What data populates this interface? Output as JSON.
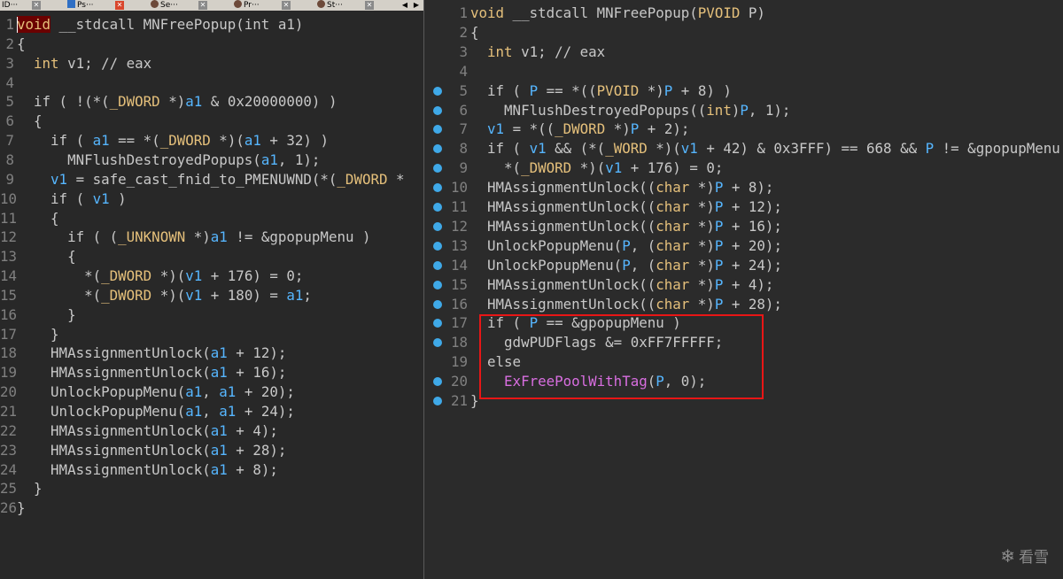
{
  "tabs": [
    {
      "label": "ID···"
    },
    {
      "label": "Ps···"
    },
    {
      "label": "Se···"
    },
    {
      "label": "Pr···"
    },
    {
      "label": "St···"
    }
  ],
  "tab_nav": {
    "prev": "◀",
    "next": "▶"
  },
  "left_pane": {
    "lines": [
      {
        "n": "1",
        "t": [
          {
            "c": "vhl",
            "s": "void"
          },
          {
            "s": " __stdcall MNFreePopup(int a1)"
          }
        ]
      },
      {
        "n": "2",
        "t": [
          {
            "s": "{"
          }
        ]
      },
      {
        "n": "3",
        "t": [
          {
            "s": "  "
          },
          {
            "c": "k",
            "s": "int"
          },
          {
            "s": " v1; // eax"
          }
        ]
      },
      {
        "n": "4",
        "t": []
      },
      {
        "n": "5",
        "t": [
          {
            "s": "  if ( !(*("
          },
          {
            "c": "k",
            "s": "_DWORD"
          },
          {
            "s": " *)"
          },
          {
            "c": "v",
            "s": "a1"
          },
          {
            "s": " & 0x20000000) )"
          }
        ]
      },
      {
        "n": "6",
        "t": [
          {
            "s": "  {"
          }
        ]
      },
      {
        "n": "7",
        "t": [
          {
            "s": "    if ( "
          },
          {
            "c": "v",
            "s": "a1"
          },
          {
            "s": " == *("
          },
          {
            "c": "k",
            "s": "_DWORD"
          },
          {
            "s": " *)("
          },
          {
            "c": "v",
            "s": "a1"
          },
          {
            "s": " + 32) )"
          }
        ]
      },
      {
        "n": "8",
        "t": [
          {
            "s": "      MNFlushDestroyedPopups("
          },
          {
            "c": "v",
            "s": "a1"
          },
          {
            "s": ", 1);"
          }
        ]
      },
      {
        "n": "9",
        "t": [
          {
            "s": "    "
          },
          {
            "c": "v",
            "s": "v1"
          },
          {
            "s": " = safe_cast_fnid_to_PMENUWND(*("
          },
          {
            "c": "k",
            "s": "_DWORD"
          },
          {
            "s": " *"
          }
        ]
      },
      {
        "n": "10",
        "t": [
          {
            "s": "    if ( "
          },
          {
            "c": "v",
            "s": "v1"
          },
          {
            "s": " )"
          }
        ]
      },
      {
        "n": "11",
        "t": [
          {
            "s": "    {"
          }
        ]
      },
      {
        "n": "12",
        "t": [
          {
            "s": "      if ( ("
          },
          {
            "c": "k",
            "s": "_UNKNOWN"
          },
          {
            "s": " *)"
          },
          {
            "c": "v",
            "s": "a1"
          },
          {
            "s": " != &gpopupMenu )"
          }
        ]
      },
      {
        "n": "13",
        "t": [
          {
            "s": "      {"
          }
        ]
      },
      {
        "n": "14",
        "t": [
          {
            "s": "        *("
          },
          {
            "c": "k",
            "s": "_DWORD"
          },
          {
            "s": " *)("
          },
          {
            "c": "v",
            "s": "v1"
          },
          {
            "s": " + 176) = 0;"
          }
        ]
      },
      {
        "n": "15",
        "t": [
          {
            "s": "        *("
          },
          {
            "c": "k",
            "s": "_DWORD"
          },
          {
            "s": " *)("
          },
          {
            "c": "v",
            "s": "v1"
          },
          {
            "s": " + 180) = "
          },
          {
            "c": "v",
            "s": "a1"
          },
          {
            "s": ";"
          }
        ]
      },
      {
        "n": "16",
        "t": [
          {
            "s": "      }"
          }
        ]
      },
      {
        "n": "17",
        "t": [
          {
            "s": "    }"
          }
        ]
      },
      {
        "n": "18",
        "t": [
          {
            "s": "    HMAssignmentUnlock("
          },
          {
            "c": "v",
            "s": "a1"
          },
          {
            "s": " + 12);"
          }
        ]
      },
      {
        "n": "19",
        "t": [
          {
            "s": "    HMAssignmentUnlock("
          },
          {
            "c": "v",
            "s": "a1"
          },
          {
            "s": " + 16);"
          }
        ]
      },
      {
        "n": "20",
        "t": [
          {
            "s": "    UnlockPopupMenu("
          },
          {
            "c": "v",
            "s": "a1"
          },
          {
            "s": ", "
          },
          {
            "c": "v",
            "s": "a1"
          },
          {
            "s": " + 20);"
          }
        ]
      },
      {
        "n": "21",
        "t": [
          {
            "s": "    UnlockPopupMenu("
          },
          {
            "c": "v",
            "s": "a1"
          },
          {
            "s": ", "
          },
          {
            "c": "v",
            "s": "a1"
          },
          {
            "s": " + 24);"
          }
        ]
      },
      {
        "n": "22",
        "t": [
          {
            "s": "    HMAssignmentUnlock("
          },
          {
            "c": "v",
            "s": "a1"
          },
          {
            "s": " + 4);"
          }
        ]
      },
      {
        "n": "23",
        "t": [
          {
            "s": "    HMAssignmentUnlock("
          },
          {
            "c": "v",
            "s": "a1"
          },
          {
            "s": " + 28);"
          }
        ]
      },
      {
        "n": "24",
        "t": [
          {
            "s": "    HMAssignmentUnlock("
          },
          {
            "c": "v",
            "s": "a1"
          },
          {
            "s": " + 8);"
          }
        ]
      },
      {
        "n": "25",
        "t": [
          {
            "s": "  }"
          }
        ]
      },
      {
        "n": "26",
        "t": [
          {
            "s": "}"
          }
        ]
      }
    ]
  },
  "right_pane": {
    "lines": [
      {
        "n": "1",
        "t": [
          {
            "c": "k",
            "s": "void"
          },
          {
            "s": " __stdcall MNFreePopup("
          },
          {
            "c": "k",
            "s": "PVOID"
          },
          {
            "s": " P)"
          }
        ]
      },
      {
        "n": "2",
        "t": [
          {
            "s": "{"
          }
        ]
      },
      {
        "n": "3",
        "t": [
          {
            "s": "  "
          },
          {
            "c": "k",
            "s": "int"
          },
          {
            "s": " v1; // eax"
          }
        ]
      },
      {
        "n": "4",
        "t": []
      },
      {
        "n": "5",
        "bp": true,
        "t": [
          {
            "s": "  if ( "
          },
          {
            "c": "v",
            "s": "P"
          },
          {
            "s": " == *(("
          },
          {
            "c": "k",
            "s": "PVOID"
          },
          {
            "s": " *)"
          },
          {
            "c": "v",
            "s": "P"
          },
          {
            "s": " + 8) )"
          }
        ]
      },
      {
        "n": "6",
        "bp": true,
        "t": [
          {
            "s": "    MNFlushDestroyedPopups(("
          },
          {
            "c": "k",
            "s": "int"
          },
          {
            "s": ")"
          },
          {
            "c": "v",
            "s": "P"
          },
          {
            "s": ", 1);"
          }
        ]
      },
      {
        "n": "7",
        "bp": true,
        "t": [
          {
            "s": "  "
          },
          {
            "c": "v",
            "s": "v1"
          },
          {
            "s": " = *(("
          },
          {
            "c": "k",
            "s": "_DWORD"
          },
          {
            "s": " *)"
          },
          {
            "c": "v",
            "s": "P"
          },
          {
            "s": " + 2);"
          }
        ]
      },
      {
        "n": "8",
        "bp": true,
        "t": [
          {
            "s": "  if ( "
          },
          {
            "c": "v",
            "s": "v1"
          },
          {
            "s": " && (*("
          },
          {
            "c": "k",
            "s": "_WORD"
          },
          {
            "s": " *)("
          },
          {
            "c": "v",
            "s": "v1"
          },
          {
            "s": " + 42) & 0x3FFF) == 668 && "
          },
          {
            "c": "v",
            "s": "P"
          },
          {
            "s": " != &gpopupMenu )"
          }
        ]
      },
      {
        "n": "9",
        "bp": true,
        "t": [
          {
            "s": "    *("
          },
          {
            "c": "k",
            "s": "_DWORD"
          },
          {
            "s": " *)("
          },
          {
            "c": "v",
            "s": "v1"
          },
          {
            "s": " + 176) = 0;"
          }
        ]
      },
      {
        "n": "10",
        "bp": true,
        "t": [
          {
            "s": "  HMAssignmentUnlock(("
          },
          {
            "c": "k",
            "s": "char"
          },
          {
            "s": " *)"
          },
          {
            "c": "v",
            "s": "P"
          },
          {
            "s": " + 8);"
          }
        ]
      },
      {
        "n": "11",
        "bp": true,
        "t": [
          {
            "s": "  HMAssignmentUnlock(("
          },
          {
            "c": "k",
            "s": "char"
          },
          {
            "s": " *)"
          },
          {
            "c": "v",
            "s": "P"
          },
          {
            "s": " + 12);"
          }
        ]
      },
      {
        "n": "12",
        "bp": true,
        "t": [
          {
            "s": "  HMAssignmentUnlock(("
          },
          {
            "c": "k",
            "s": "char"
          },
          {
            "s": " *)"
          },
          {
            "c": "v",
            "s": "P"
          },
          {
            "s": " + 16);"
          }
        ]
      },
      {
        "n": "13",
        "bp": true,
        "t": [
          {
            "s": "  UnlockPopupMenu("
          },
          {
            "c": "v",
            "s": "P"
          },
          {
            "s": ", ("
          },
          {
            "c": "k",
            "s": "char"
          },
          {
            "s": " *)"
          },
          {
            "c": "v",
            "s": "P"
          },
          {
            "s": " + 20);"
          }
        ]
      },
      {
        "n": "14",
        "bp": true,
        "t": [
          {
            "s": "  UnlockPopupMenu("
          },
          {
            "c": "v",
            "s": "P"
          },
          {
            "s": ", ("
          },
          {
            "c": "k",
            "s": "char"
          },
          {
            "s": " *)"
          },
          {
            "c": "v",
            "s": "P"
          },
          {
            "s": " + 24);"
          }
        ]
      },
      {
        "n": "15",
        "bp": true,
        "t": [
          {
            "s": "  HMAssignmentUnlock(("
          },
          {
            "c": "k",
            "s": "char"
          },
          {
            "s": " *)"
          },
          {
            "c": "v",
            "s": "P"
          },
          {
            "s": " + 4);"
          }
        ]
      },
      {
        "n": "16",
        "bp": true,
        "t": [
          {
            "s": "  HMAssignmentUnlock(("
          },
          {
            "c": "k",
            "s": "char"
          },
          {
            "s": " *)"
          },
          {
            "c": "v",
            "s": "P"
          },
          {
            "s": " + 28);"
          }
        ]
      },
      {
        "n": "17",
        "bp": true,
        "t": [
          {
            "s": "  if ( "
          },
          {
            "c": "v",
            "s": "P"
          },
          {
            "s": " == &gpopupMenu )"
          }
        ]
      },
      {
        "n": "18",
        "bp": true,
        "t": [
          {
            "s": "    gdwPUDFlags &= 0xFF7FFFFF;"
          }
        ]
      },
      {
        "n": "19",
        "t": [
          {
            "s": "  else"
          }
        ]
      },
      {
        "n": "20",
        "bp": true,
        "t": [
          {
            "s": "    "
          },
          {
            "c": "f",
            "s": "ExFreePoolWithTag"
          },
          {
            "s": "("
          },
          {
            "c": "v",
            "s": "P"
          },
          {
            "s": ", 0);"
          }
        ]
      },
      {
        "n": "21",
        "bp": true,
        "t": [
          {
            "s": "}"
          }
        ]
      }
    ]
  },
  "watermark": {
    "icon": "snowflake-icon",
    "glyph": "❄",
    "text": "看雪"
  },
  "colors": {
    "keyword": "#e5c07b",
    "variable": "#56b6ff",
    "function": "#d86ee0",
    "highlight_box": "#e81616",
    "breakpoint": "#3fa9e8"
  }
}
